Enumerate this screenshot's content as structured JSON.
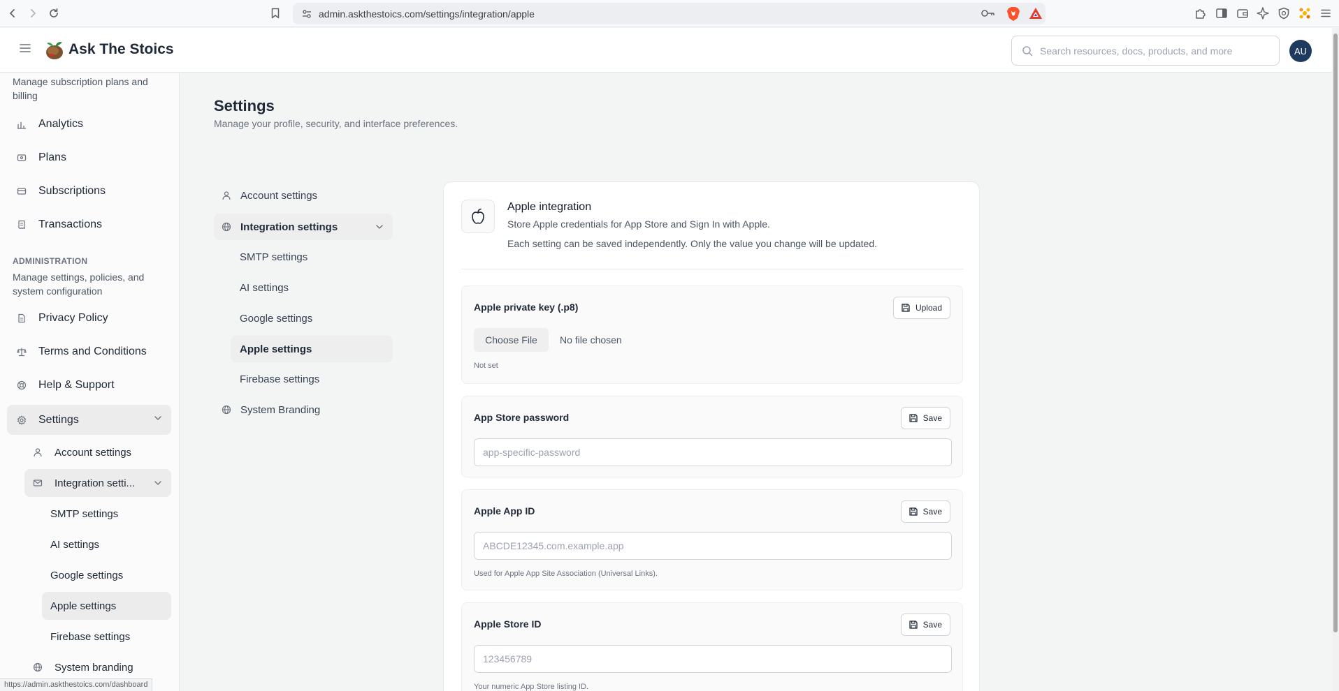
{
  "browser": {
    "url": "admin.askthestoics.com/settings/integration/apple",
    "status_link": "https://admin.askthestoics.com/dashboard"
  },
  "header": {
    "app_name": "Ask The Stoics",
    "search_placeholder": "Search resources, docs, products, and more",
    "avatar_initials": "AU"
  },
  "sidebar": {
    "top_description": "Manage subscription plans and billing",
    "billing_items": [
      {
        "label": "Analytics",
        "icon": "bar-chart-icon"
      },
      {
        "label": "Plans",
        "icon": "card-icon"
      },
      {
        "label": "Subscriptions",
        "icon": "credit-card-icon"
      },
      {
        "label": "Transactions",
        "icon": "receipt-icon"
      }
    ],
    "admin_heading": "ADMINISTRATION",
    "admin_description": "Manage settings, policies, and system configuration",
    "admin_items": [
      {
        "label": "Privacy Policy",
        "icon": "document-icon"
      },
      {
        "label": "Terms and Conditions",
        "icon": "scale-icon"
      },
      {
        "label": "Help & Support",
        "icon": "lifebuoy-icon"
      },
      {
        "label": "Settings",
        "icon": "gear-icon"
      }
    ],
    "settings_children": {
      "account": "Account settings",
      "integration": "Integration setti...",
      "integration_children": [
        "SMTP settings",
        "AI settings",
        "Google settings",
        "Apple settings",
        "Firebase settings"
      ],
      "branding": "System branding"
    }
  },
  "page": {
    "title": "Settings",
    "subtitle": "Manage your profile, security, and interface preferences."
  },
  "settings_nav": {
    "account": "Account settings",
    "integration": "Integration settings",
    "integration_children": [
      "SMTP settings",
      "AI settings",
      "Google settings",
      "Apple settings",
      "Firebase settings"
    ],
    "branding": "System Branding"
  },
  "card": {
    "title": "Apple integration",
    "description": "Store Apple credentials for App Store and Sign In with Apple.",
    "note": "Each setting can be saved independently. Only the value you change will be updated.",
    "fields": {
      "private_key": {
        "label": "Apple private key (.p8)",
        "button": "Upload",
        "choose_file": "Choose File",
        "no_file": "No file chosen",
        "status": "Not set"
      },
      "app_store_password": {
        "label": "App Store password",
        "button": "Save",
        "value": "",
        "placeholder": "app-specific-password"
      },
      "app_id": {
        "label": "Apple App ID",
        "button": "Save",
        "value": "",
        "placeholder": "ABCDE12345.com.example.app",
        "help": "Used for Apple App Site Association (Universal Links)."
      },
      "store_id": {
        "label": "Apple Store ID",
        "button": "Save",
        "value": "",
        "placeholder": "123456789",
        "help": "Your numeric App Store listing ID."
      }
    }
  },
  "colors": {
    "active_bg": "#ececec",
    "avatar_bg": "#1e3a5f",
    "page_bg": "#f3f4f4"
  }
}
